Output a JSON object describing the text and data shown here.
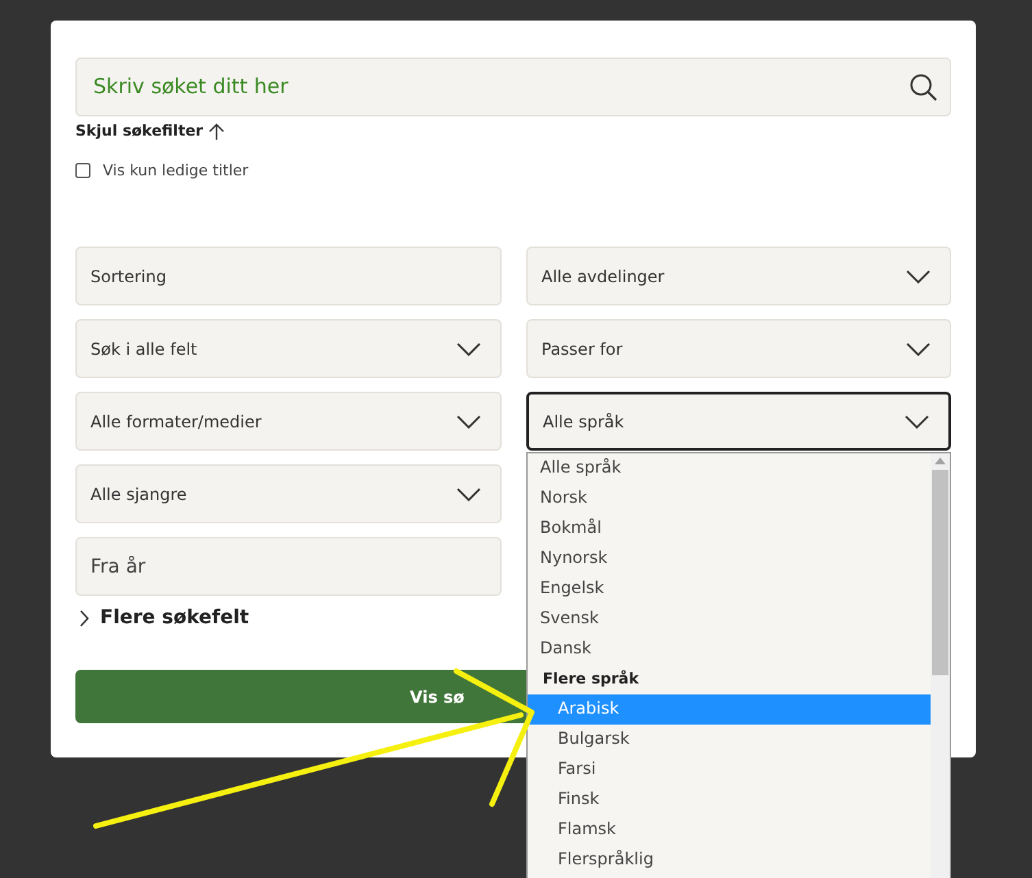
{
  "search": {
    "placeholder": "Skriv søket ditt her"
  },
  "filter_toggle": {
    "label": "Skjul søkefilter",
    "expanded": true
  },
  "available_only": {
    "label": "Vis kun ledige titler",
    "checked": false
  },
  "filters": [
    {
      "kind": "plain",
      "label": "Sortering",
      "focused": false
    },
    {
      "kind": "select",
      "label": "Alle avdelinger",
      "focused": false
    },
    {
      "kind": "select",
      "label": "Søk i alle felt",
      "focused": false
    },
    {
      "kind": "select",
      "label": "Passer for",
      "focused": false
    },
    {
      "kind": "select",
      "label": "Alle formater/medier",
      "focused": false
    },
    {
      "kind": "select",
      "label": "Alle språk",
      "focused": true
    },
    {
      "kind": "select",
      "label": "Alle sjangre",
      "focused": false
    },
    {
      "kind": "input",
      "placeholder": "Fra år"
    }
  ],
  "more_fields": {
    "label": "Flere søkefelt",
    "expanded": false
  },
  "submit_button": {
    "label": "Vis sø"
  },
  "language_dropdown": {
    "options": [
      {
        "kind": "option",
        "label": "Alle språk",
        "selected": false
      },
      {
        "kind": "option",
        "label": "Norsk",
        "selected": false
      },
      {
        "kind": "option",
        "label": "Bokmål",
        "selected": false
      },
      {
        "kind": "option",
        "label": "Nynorsk",
        "selected": false
      },
      {
        "kind": "option",
        "label": "Engelsk",
        "selected": false
      },
      {
        "kind": "option",
        "label": "Svensk",
        "selected": false
      },
      {
        "kind": "option",
        "label": "Dansk",
        "selected": false
      },
      {
        "kind": "group",
        "label": "Flere språk",
        "children": [
          {
            "kind": "option",
            "label": "Arabisk",
            "selected": true
          },
          {
            "kind": "option",
            "label": "Bulgarsk",
            "selected": false
          },
          {
            "kind": "option",
            "label": "Farsi",
            "selected": false
          },
          {
            "kind": "option",
            "label": "Finsk",
            "selected": false
          },
          {
            "kind": "option",
            "label": "Flamsk",
            "selected": false
          },
          {
            "kind": "option",
            "label": "Flerspråklig",
            "selected": false
          }
        ]
      }
    ]
  },
  "annotation": {
    "kind": "arrow"
  }
}
